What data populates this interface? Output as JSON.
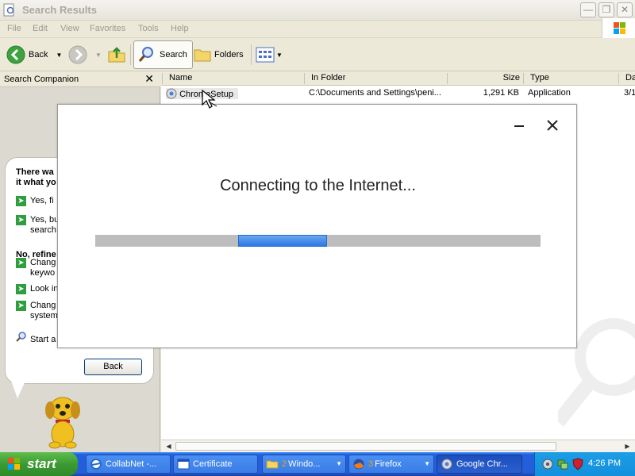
{
  "window": {
    "title": "Search Results",
    "menu": [
      "File",
      "Edit",
      "View",
      "Favorites",
      "Tools",
      "Help"
    ]
  },
  "toolbar": {
    "back_label": "Back",
    "search_label": "Search",
    "folders_label": "Folders"
  },
  "search_companion": {
    "header": "Search Companion",
    "question_fragment": "There wa\nit what yo",
    "options_top": [
      {
        "text": "Yes, fi"
      },
      {
        "text": "Yes, bu\nsearch"
      }
    ],
    "refine_label": "No, refine",
    "options_refine": [
      {
        "text": "Chang\nkeywo"
      },
      {
        "text": "Look in"
      },
      {
        "text": "Chang\nsystem"
      }
    ],
    "start_label": "Start a",
    "back_button": "Back"
  },
  "results": {
    "columns": [
      "Name",
      "In Folder",
      "Size",
      "Type",
      "Da"
    ],
    "rows": [
      {
        "name": "ChromeSetup",
        "folder": "C:\\Documents and Settings\\peni...",
        "size": "1,291 KB",
        "type": "Application",
        "date": "3/1"
      }
    ]
  },
  "dialog": {
    "status_text": "Connecting to the Internet...",
    "progress": {
      "start_fraction": 0.32,
      "width_fraction": 0.2
    }
  },
  "taskbar": {
    "start_label": "start",
    "tasks": [
      {
        "label": "CollabNet -..."
      },
      {
        "label": "Certificate"
      },
      {
        "label": "Windo...",
        "count": "2"
      },
      {
        "label": "Firefox",
        "count": "3"
      },
      {
        "label": "Google Chr..."
      }
    ],
    "clock": "4:26 PM"
  },
  "colors": {
    "progress_fill": "#2a78e4",
    "progress_track": "#bdbdbd",
    "taskbar": "#245edb",
    "start_button": "#3c9a33"
  }
}
